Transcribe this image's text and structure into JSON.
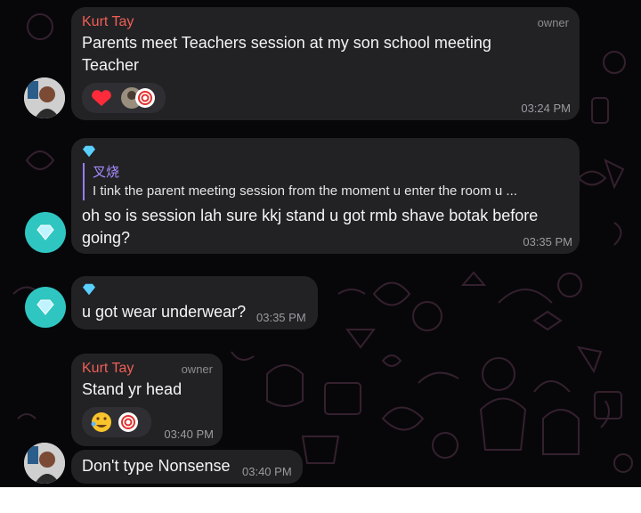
{
  "messages": [
    {
      "sender": "Kurt Tay",
      "role": "owner",
      "text_lines": [
        "Parents meet Teachers session at my son school meeting",
        "Teacher"
      ],
      "time": "03:24 PM",
      "reactions": [
        "heart-reaction",
        "user-avatar-reaction",
        "swirl-reaction"
      ]
    },
    {
      "sender_icon": "diamond-icon",
      "reply": {
        "name": "叉烧",
        "text": "I tink the parent meeting session from the moment u enter the room u ..."
      },
      "text_lines": [
        "oh so is session lah sure kkj stand u got rmb shave botak before",
        "going?"
      ],
      "time": "03:35 PM"
    },
    {
      "sender_icon": "diamond-icon",
      "text_lines": [
        "u got wear underwear?"
      ],
      "time": "03:35 PM"
    },
    {
      "sender": "Kurt Tay",
      "role": "owner",
      "text_lines": [
        "Stand yr head"
      ],
      "time": "03:40 PM",
      "reactions": [
        "rolling-laugh-emoji",
        "swirl-reaction"
      ]
    },
    {
      "text_lines": [
        "Don't type Nonsense"
      ],
      "time": "03:40 PM"
    }
  ],
  "colors": {
    "background": "#07070a",
    "bubble": "#222225",
    "sender_name": "#ef5f55",
    "reply_accent": "#a98cff",
    "gem_avatar": "#2fc6c1"
  }
}
